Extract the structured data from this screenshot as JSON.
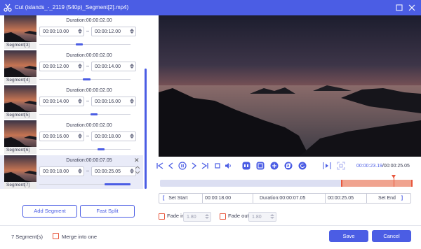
{
  "window": {
    "title": "Cut (islands_-_2119 (540p)_Segment[2].mp4)",
    "colors": {
      "accent": "#4b5de4",
      "highlight": "#e8573d",
      "range": "#f0a38f"
    }
  },
  "segments": [
    {
      "label": "Segment[3]",
      "duration": "Duration:00:00:02.00",
      "start": "00:00:10.00",
      "end": "00:00:12.00",
      "selected": false
    },
    {
      "label": "Segment[4]",
      "duration": "Duration:00:00:02.00",
      "start": "00:00:12.00",
      "end": "00:00:14.00",
      "selected": false
    },
    {
      "label": "Segment[5]",
      "duration": "Duration:00:00:02.00",
      "start": "00:00:14.00",
      "end": "00:00:16.00",
      "selected": false
    },
    {
      "label": "Segment[6]",
      "duration": "Duration:00:00:02.00",
      "start": "00:00:16.00",
      "end": "00:00:18.00",
      "selected": false
    },
    {
      "label": "Segment[7]",
      "duration": "Duration:00:00:07.05",
      "start": "00:00:18.00",
      "end": "00:00:25.05",
      "selected": true
    }
  ],
  "left_buttons": {
    "add_segment": "Add Segment",
    "fast_split": "Fast Split"
  },
  "player": {
    "time_current": "00:00:23.19",
    "time_total": "/00:00:25.05",
    "icons": [
      "skip-to-start-icon",
      "previous-frame-icon",
      "pause-icon",
      "next-frame-icon",
      "skip-to-end-icon",
      "stop-icon",
      "volume-icon",
      "loop-segment-icon",
      "snapshot-icon",
      "add-icon",
      "copy-icon",
      "rotate-icon",
      "play-range-icon",
      "fullscreen-icon"
    ]
  },
  "timeline": {
    "total_seconds": 25.05,
    "range_start_seconds": 18.0,
    "range_end_seconds": 25.05,
    "playhead_seconds": 23.19
  },
  "set_bar": {
    "set_start": "Set Start",
    "start_time": "00:00:18.00",
    "duration": "Duration:00:00:07.05",
    "end_time": "00:00:25.05",
    "set_end": "Set End"
  },
  "fade": {
    "fade_in_label": "Fade in",
    "fade_in_value": "1.80",
    "fade_out_label": "Fade out",
    "fade_out_value": "1.80"
  },
  "footer": {
    "segment_count": "7 Segment(s)",
    "merge_label": "Merge into one",
    "save": "Save",
    "cancel": "Cancel"
  }
}
